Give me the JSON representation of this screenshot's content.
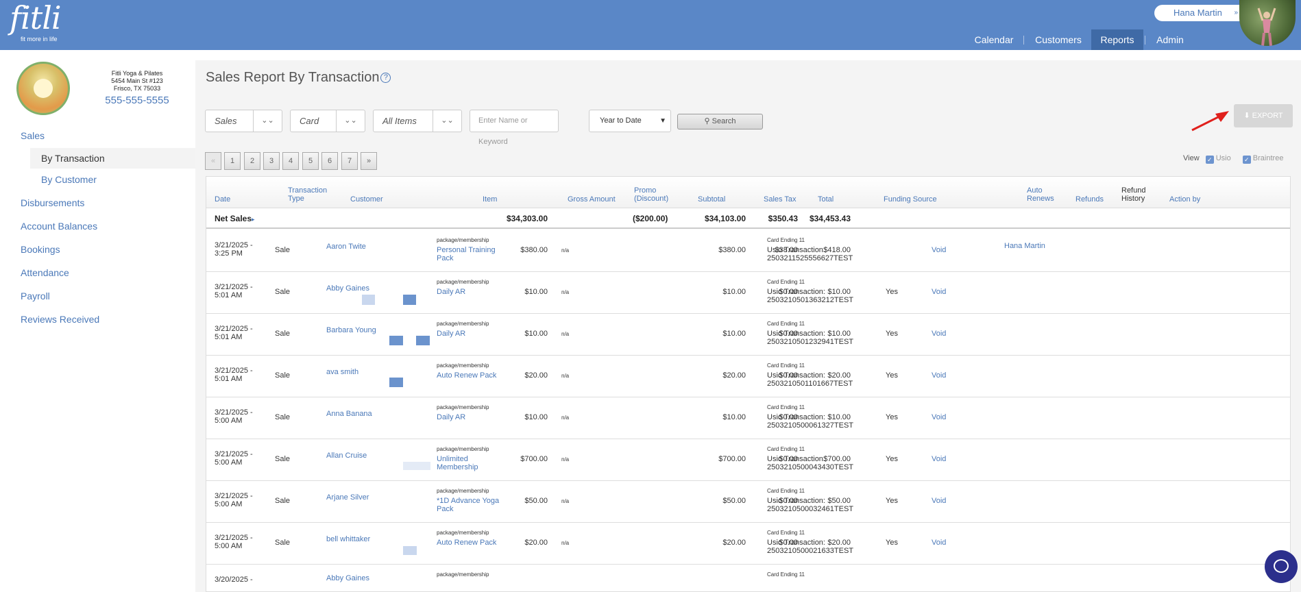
{
  "brand": {
    "logo": "fitli",
    "tagline": "fit more in life"
  },
  "user": {
    "name": "Hana Martin"
  },
  "nav": {
    "calendar": "Calendar",
    "customers": "Customers",
    "reports": "Reports",
    "admin": "Admin"
  },
  "studio": {
    "name": "Fitli Yoga & Pilates",
    "address1": "5454 Main St #123",
    "address2": "Frisco, TX 75033",
    "phone": "555-555-5555"
  },
  "sidebar": {
    "sales": "Sales",
    "by_transaction": "By Transaction",
    "by_customer": "By Customer",
    "disbursements": "Disbursements",
    "account_balances": "Account Balances",
    "bookings": "Bookings",
    "attendance": "Attendance",
    "payroll": "Payroll",
    "reviews": "Reviews Received"
  },
  "page": {
    "title": "Sales Report By Transaction",
    "help": "?"
  },
  "filters": {
    "type": "Sales",
    "payment": "Card",
    "items": "All Items",
    "keyword_placeholder": "Enter Name or Keyword",
    "period": "Year to Date",
    "search": "Search",
    "export": "EXPORT"
  },
  "pager": {
    "prev": "«",
    "pages": [
      "1",
      "2",
      "3",
      "4",
      "5",
      "6",
      "7"
    ],
    "next": "»"
  },
  "view": {
    "label": "View",
    "usio": "Usio",
    "braintree": "Braintree"
  },
  "columns": {
    "date": "Date",
    "type1": "Transaction",
    "type2": "Type",
    "customer": "Customer",
    "item": "Item",
    "gross": "Gross Amount",
    "promo1": "Promo",
    "promo2": "(Discount)",
    "subtotal": "Subtotal",
    "tax": "Sales Tax",
    "total": "Total",
    "funding": "Funding Source",
    "auto1": "Auto",
    "auto2": "Renews",
    "refunds": "Refunds",
    "refhist1": "Refund",
    "refhist2": "History",
    "action": "Action by"
  },
  "net_sales": {
    "label": "Net Sales",
    "gross": "$34,303.00",
    "promo": "($200.00)",
    "subtotal": "$34,103.00",
    "tax": "$350.43",
    "total": "$34,453.43"
  },
  "rows": [
    {
      "date1": "3/21/2025 -",
      "date2": "3:25 PM",
      "type": "Sale",
      "customer": "Aaron Twite",
      "pkg": "package/membership",
      "item1": "Personal Training",
      "item2": "Pack",
      "gross": "$380.00",
      "promo": "n/a",
      "subtotal": "$380.00",
      "tax": "$38.00",
      "total": "$418.00",
      "card": "Card Ending 11",
      "usio": "Usio Transaction:",
      "txn": "2503211525556627TEST",
      "auto": "",
      "refund": "Void",
      "action": "Hana Martin"
    },
    {
      "date1": "3/21/2025 -",
      "date2": "5:01 AM",
      "type": "Sale",
      "customer": "Abby Gaines",
      "pkg": "package/membership",
      "item1": "Daily AR",
      "item2": "",
      "gross": "$10.00",
      "promo": "n/a",
      "subtotal": "$10.00",
      "tax": "$0.00",
      "total": "$10.00",
      "card": "Card Ending 11",
      "usio": "Usio Transaction:",
      "txn": "2503210501363212TEST",
      "auto": "Yes",
      "refund": "Void",
      "action": ""
    },
    {
      "date1": "3/21/2025 -",
      "date2": "5:01 AM",
      "type": "Sale",
      "customer": "Barbara Young",
      "pkg": "package/membership",
      "item1": "Daily AR",
      "item2": "",
      "gross": "$10.00",
      "promo": "n/a",
      "subtotal": "$10.00",
      "tax": "$0.00",
      "total": "$10.00",
      "card": "Card Ending 11",
      "usio": "Usio Transaction:",
      "txn": "2503210501232941TEST",
      "auto": "Yes",
      "refund": "Void",
      "action": ""
    },
    {
      "date1": "3/21/2025 -",
      "date2": "5:01 AM",
      "type": "Sale",
      "customer": "ava smith",
      "pkg": "package/membership",
      "item1": "Auto Renew Pack",
      "item2": "",
      "gross": "$20.00",
      "promo": "n/a",
      "subtotal": "$20.00",
      "tax": "$0.00",
      "total": "$20.00",
      "card": "Card Ending 11",
      "usio": "Usio Transaction:",
      "txn": "2503210501101667TEST",
      "auto": "Yes",
      "refund": "Void",
      "action": ""
    },
    {
      "date1": "3/21/2025 -",
      "date2": "5:00 AM",
      "type": "Sale",
      "customer": "Anna Banana",
      "pkg": "package/membership",
      "item1": "Daily AR",
      "item2": "",
      "gross": "$10.00",
      "promo": "n/a",
      "subtotal": "$10.00",
      "tax": "$0.00",
      "total": "$10.00",
      "card": "Card Ending 11",
      "usio": "Usio Transaction:",
      "txn": "2503210500061327TEST",
      "auto": "Yes",
      "refund": "Void",
      "action": ""
    },
    {
      "date1": "3/21/2025 -",
      "date2": "5:00 AM",
      "type": "Sale",
      "customer": "Allan Cruise",
      "pkg": "package/membership",
      "item1": "Unlimited",
      "item2": "Membership",
      "gross": "$700.00",
      "promo": "n/a",
      "subtotal": "$700.00",
      "tax": "$0.00",
      "total": "$700.00",
      "card": "Card Ending 11",
      "usio": "Usio Transaction:",
      "txn": "2503210500043430TEST",
      "auto": "Yes",
      "refund": "Void",
      "action": ""
    },
    {
      "date1": "3/21/2025 -",
      "date2": "5:00 AM",
      "type": "Sale",
      "customer": "Arjane Silver",
      "pkg": "package/membership",
      "item1": "*1D Advance Yoga",
      "item2": "Pack",
      "gross": "$50.00",
      "promo": "n/a",
      "subtotal": "$50.00",
      "tax": "$0.00",
      "total": "$50.00",
      "card": "Card Ending 11",
      "usio": "Usio Transaction:",
      "txn": "2503210500032461TEST",
      "auto": "Yes",
      "refund": "Void",
      "action": ""
    },
    {
      "date1": "3/21/2025 -",
      "date2": "5:00 AM",
      "type": "Sale",
      "customer": "bell whittaker",
      "pkg": "package/membership",
      "item1": "Auto Renew Pack",
      "item2": "",
      "gross": "$20.00",
      "promo": "n/a",
      "subtotal": "$20.00",
      "tax": "$0.00",
      "total": "$20.00",
      "card": "Card Ending 11",
      "usio": "Usio Transaction:",
      "txn": "2503210500021633TEST",
      "auto": "Yes",
      "refund": "Void",
      "action": ""
    },
    {
      "date1": "3/20/2025 -",
      "date2": "",
      "type": "",
      "customer": "Abby Gaines",
      "pkg": "package/membership",
      "item1": "",
      "item2": "",
      "gross": "",
      "promo": "",
      "subtotal": "",
      "tax": "",
      "total": "",
      "card": "Card Ending 11",
      "usio": "",
      "txn": "",
      "auto": "",
      "refund": "",
      "action": ""
    }
  ]
}
